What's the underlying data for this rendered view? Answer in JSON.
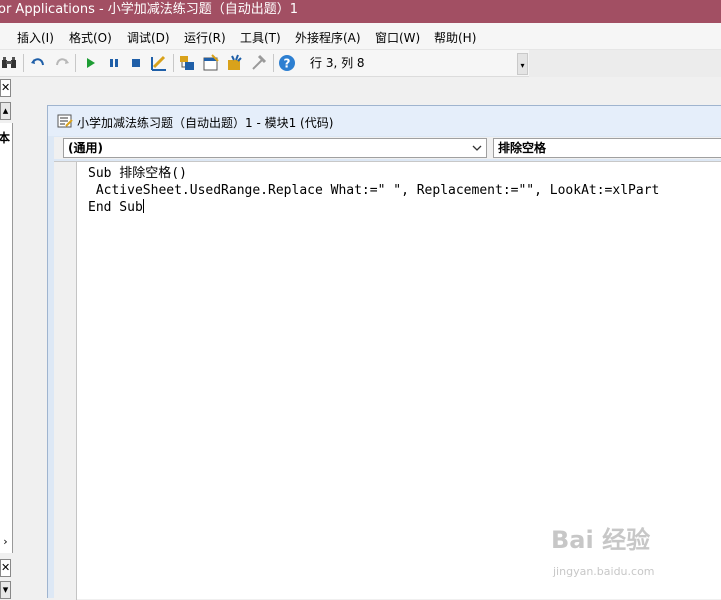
{
  "window": {
    "title": "or Applications - 小学加减法练习题（自动出题）1"
  },
  "menu": [
    "插入(I)",
    "格式(O)",
    "调试(D)",
    "运行(R)",
    "工具(T)",
    "外接程序(A)",
    "窗口(W)",
    "帮助(H)"
  ],
  "toolbar": {
    "icons": [
      "binoculars-icon",
      "undo-icon",
      "redo-icon",
      "run-icon",
      "break-icon",
      "reset-icon",
      "design-mode-icon",
      "project-explorer-icon",
      "properties-icon",
      "object-browser-icon",
      "toolbox-icon",
      "help-icon"
    ],
    "status": "行 3, 列 8",
    "colors": {
      "run": "#1e9d34",
      "help": "#2d7fd1",
      "undo": "#1f5fa8"
    }
  },
  "left_pane": {
    "fragment": "本"
  },
  "code_window": {
    "title": "小学加减法练习题（自动出题）1 - 模块1 (代码)",
    "object_combo": "(通用)",
    "procedure_combo": "排除空格",
    "lines": [
      "Sub 排除空格()",
      " ActiveSheet.UsedRange.Replace What:=\" \", Replacement:=\"\", LookAt:=xlPart",
      "End Sub"
    ]
  },
  "watermark": {
    "main": "Bai 经验",
    "sub": "jingyan.baidu.com"
  },
  "colors": {
    "titlebar": "#a24f63",
    "codewin_title": "#e5eefa"
  }
}
